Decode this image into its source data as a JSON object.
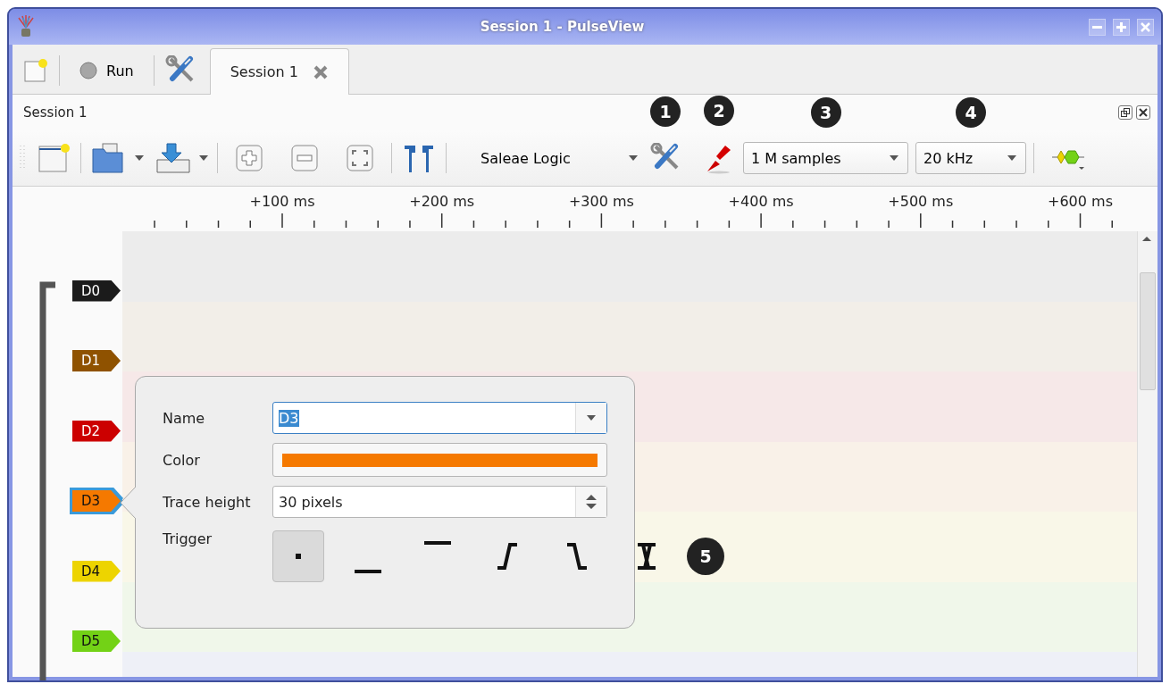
{
  "window": {
    "title": "Session 1 - PulseView"
  },
  "main_toolbar": {
    "run_label": "Run"
  },
  "tabs": [
    {
      "label": "Session 1",
      "selected": true
    }
  ],
  "session": {
    "title": "Session 1",
    "device": "Saleae Logic",
    "samples": "1 M samples",
    "samplerate": "20 kHz"
  },
  "callouts": {
    "config": "1",
    "probes": "2",
    "samples": "3",
    "samplerate": "4",
    "trigger": "5"
  },
  "ruler": {
    "labels": [
      "+100 ms",
      "+200 ms",
      "+300 ms",
      "+400 ms",
      "+500 ms",
      "+600 ms"
    ]
  },
  "channels": [
    {
      "name": "D0",
      "color": "#1b1b1b",
      "selected": false
    },
    {
      "name": "D1",
      "color": "#8f5200",
      "selected": false
    },
    {
      "name": "D2",
      "color": "#cc0000",
      "selected": false
    },
    {
      "name": "D3",
      "color": "#f57900",
      "selected": true
    },
    {
      "name": "D4",
      "color": "#edd400",
      "selected": false
    },
    {
      "name": "D5",
      "color": "#73d216",
      "selected": false
    }
  ],
  "popup": {
    "fields": [
      {
        "kind": "combo",
        "label": "Name",
        "value": "D3",
        "value_selected": true
      },
      {
        "kind": "color",
        "label": "Color",
        "color": "#f57900"
      },
      {
        "kind": "spin",
        "label": "Trace height",
        "value": "30 pixels"
      },
      {
        "kind": "trigger",
        "label": "Trigger",
        "options": [
          {
            "kind": "none",
            "selected": true
          },
          {
            "kind": "low",
            "selected": false
          },
          {
            "kind": "high",
            "selected": false
          },
          {
            "kind": "rising",
            "selected": false
          },
          {
            "kind": "falling",
            "selected": false
          },
          {
            "kind": "change",
            "selected": false
          }
        ]
      }
    ]
  }
}
